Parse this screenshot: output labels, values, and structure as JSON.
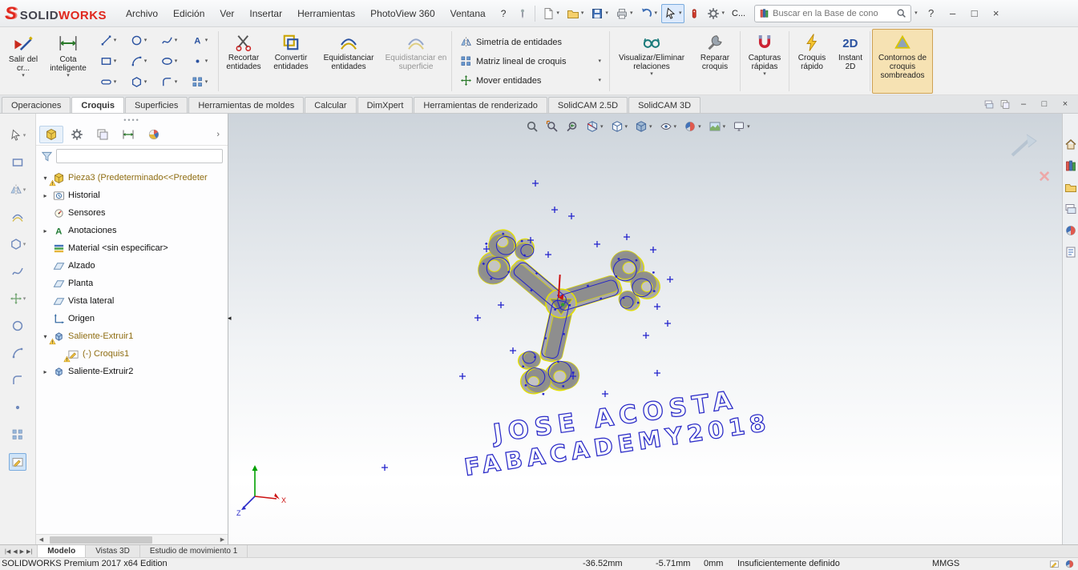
{
  "brand": {
    "mark": "S",
    "solid": "SOLID",
    "works": "WORKS"
  },
  "titlebar": {
    "menus": [
      "Archivo",
      "Edición",
      "Ver",
      "Insertar",
      "Herramientas",
      "PhotoView 360",
      "Ventana",
      "?"
    ],
    "collab": "C...",
    "search": {
      "placeholder": "Buscar en la Base de cono"
    },
    "help": "?"
  },
  "window_controls": {
    "minimize": "–",
    "maximize": "□",
    "close": "×"
  },
  "ribbon": {
    "exit_sketch": "Salir del cr...",
    "smart_dim": "Cota inteligente",
    "trim": "Recortar entidades",
    "convert": "Convertir entidades",
    "offset": "Equidistanciar entidades",
    "offset_surface": "Equidistanciar en superficie",
    "mirror": "Simetría de entidades",
    "pattern": "Matriz lineal de croquis",
    "move": "Mover entidades",
    "relations": "Visualizar/Eliminar relaciones",
    "repair": "Reparar croquis",
    "snaps": "Capturas rápidas",
    "quick_sketch": "Croquis rápido",
    "instant2d": "Instant 2D",
    "shaded_contours": "Contornos de croquis sombreados"
  },
  "command_tabs": [
    "Operaciones",
    "Croquis",
    "Superficies",
    "Herramientas de moldes",
    "Calcular",
    "DimXpert",
    "Herramientas de renderizado",
    "SolidCAM 2.5D",
    "SolidCAM 3D"
  ],
  "feature_tree": {
    "root": "Pieza3 (Predeterminado<<Predeter",
    "items": [
      "Historial",
      "Sensores",
      "Anotaciones",
      "Material <sin especificar>",
      "Alzado",
      "Planta",
      "Vista lateral",
      "Origen",
      "Saliente-Extruir1",
      "(-) Croquis1",
      "Saliente-Extruir2"
    ]
  },
  "viewport": {
    "sketch_text_line1": "JOSE ACOSTA",
    "sketch_text_line2": "FABACADEMY2018",
    "triad": {
      "x": "X",
      "z": "Z"
    }
  },
  "doc_tabs": [
    "Modelo",
    "Vistas 3D",
    "Estudio de movimiento 1"
  ],
  "statusbar": {
    "edition": "SOLIDWORKS Premium 2017 x64 Edition",
    "x": "-36.52mm",
    "y": "-5.71mm",
    "z": "0mm",
    "state": "Insuficientemente definido",
    "units": "MMGS"
  },
  "colors": {
    "edge_yellow": "#e4e000",
    "sketch_blue": "#2323cc",
    "warning": "#f2b200",
    "active_button_bg": "#f6e2b3"
  }
}
